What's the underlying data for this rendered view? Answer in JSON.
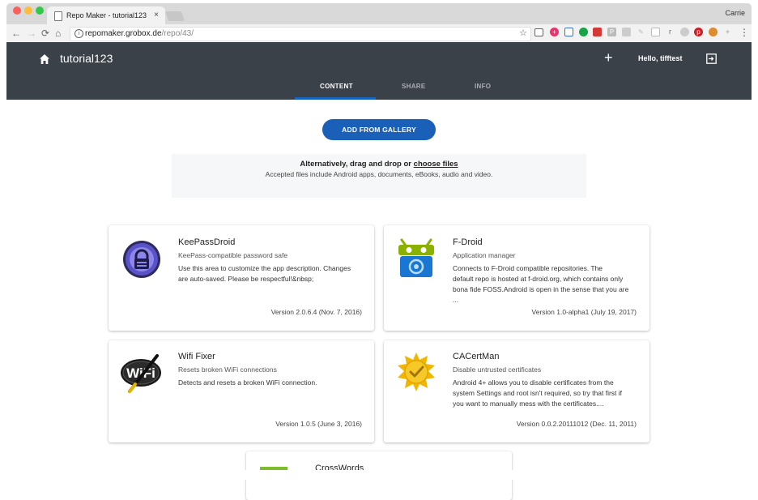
{
  "browser": {
    "tab_title": "Repo Maker - tutorial123",
    "tab_close": "×",
    "user_name": "Carrie",
    "url_host": "repomaker.grobox.de",
    "url_path": "/repo/43/",
    "nav": {
      "back": "←",
      "forward": "→",
      "reload": "⟳",
      "home": "⌂"
    },
    "star": "☆",
    "menu": "⋮",
    "extension_icons": [
      "cast-icon",
      "plus-circle-icon",
      "frame-icon",
      "green-dot-icon",
      "red-badge-icon",
      "p-icon",
      "gray-icon",
      "pen-icon",
      "box-icon",
      "r-icon",
      "cloud-icon",
      "pinterest-icon",
      "fox-icon",
      "feather-icon",
      "grid-icon"
    ],
    "extension_r": "r"
  },
  "app": {
    "title": "tutorial123",
    "add": "+",
    "greeting": "Hello, tifftest",
    "tabs": [
      {
        "label": "CONTENT",
        "active": true
      },
      {
        "label": "SHARE",
        "active": false
      },
      {
        "label": "INFO",
        "active": false
      }
    ],
    "colors": {
      "header": "#3b4149",
      "accent": "#1a5fb8"
    }
  },
  "main": {
    "gallery_button": "ADD FROM GALLERY",
    "drop_text": "Alternatively, drag and drop or ",
    "drop_link": "choose files",
    "accepted_text": "Accepted files include Android apps, documents, eBooks, audio and video."
  },
  "apps": [
    {
      "name": "KeePassDroid",
      "summary": "KeePass-compatible password safe",
      "desc_lines": [
        "Use this area to customize the app description. Changes",
        "are auto-saved. Please be respectful!&nbsp;"
      ],
      "version": "Version 2.0.6.4 (Nov. 7, 2016)",
      "icon": "keepassdroid-icon"
    },
    {
      "name": "F-Droid",
      "summary": "Application manager",
      "desc_lines": [
        "Connects to F-Droid compatible repositories. The",
        "default repo is hosted at f-droid.org, which contains only",
        "bona fide FOSS.Android is open in the sense that you are",
        "..."
      ],
      "version": "Version 1.0-alpha1 (July 19, 2017)",
      "icon": "fdroid-icon"
    },
    {
      "name": "Wifi Fixer",
      "summary": "Resets broken WiFi connections",
      "desc_lines": [
        "Detects and resets a broken WiFi connection."
      ],
      "version": "Version 1.0.5 (June 3, 2016)",
      "icon": "wifi-fixer-icon",
      "icon_text": "WiFi"
    },
    {
      "name": "CACertMan",
      "summary": "Disable untrusted certificates",
      "desc_lines": [
        "Android 4+ allows you to disable certificates from the",
        "system Settings and root isn't required, so try that first if",
        "you want to manually mess with the certificates...."
      ],
      "version": "Version 0.0.2.20111012 (Dec. 11, 2011)",
      "icon": "cacertman-icon"
    },
    {
      "name": "CrossWords",
      "icon": "crosswords-icon"
    }
  ]
}
